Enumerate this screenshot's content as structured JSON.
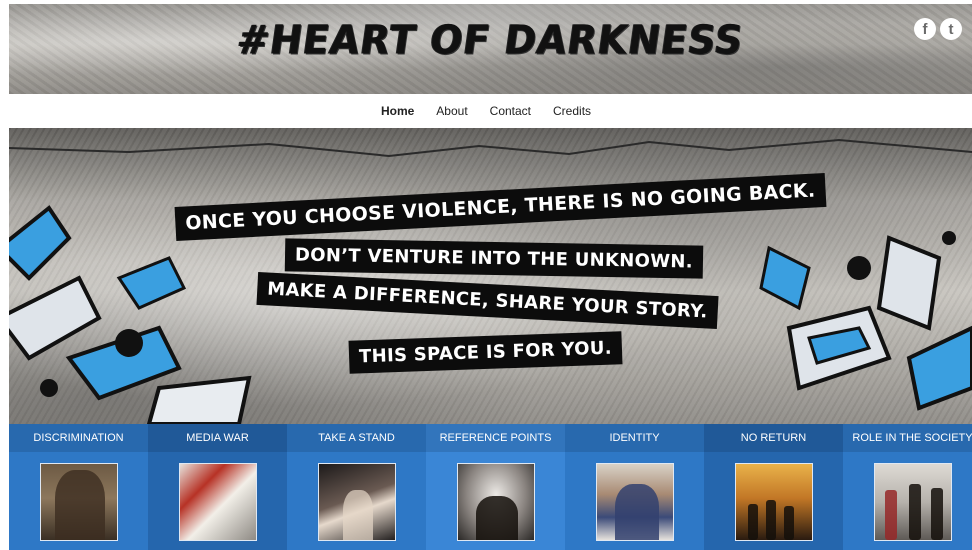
{
  "header": {
    "logo_text": "#HEART OF DARKNESS",
    "social": [
      {
        "icon": "facebook-icon",
        "glyph": "f"
      },
      {
        "icon": "twitter-icon",
        "glyph": "t"
      }
    ]
  },
  "nav": {
    "items": [
      {
        "label": "Home",
        "active": true
      },
      {
        "label": "About",
        "active": false
      },
      {
        "label": "Contact",
        "active": false
      },
      {
        "label": "Credits",
        "active": false
      }
    ]
  },
  "hero": {
    "lines": [
      "ONCE YOU CHOOSE VIOLENCE, THERE IS NO GOING BACK.",
      "DON’T VENTURE INTO THE UNKNOWN.",
      "MAKE A DIFFERENCE, SHARE YOUR STORY.",
      "THIS SPACE IS FOR YOU."
    ]
  },
  "categories": [
    {
      "label": "DISCRIMINATION"
    },
    {
      "label": "MEDIA WAR"
    },
    {
      "label": "TAKE A STAND"
    },
    {
      "label": "REFERENCE POINTS"
    },
    {
      "label": "IDENTITY"
    },
    {
      "label": "NO RETURN"
    },
    {
      "label": "ROLE IN THE SOCIETY"
    }
  ],
  "colors": {
    "category_bar": "#2e78c6",
    "category_bar_alt": "#2566ad",
    "graffiti_blue": "#3a9fe0"
  }
}
